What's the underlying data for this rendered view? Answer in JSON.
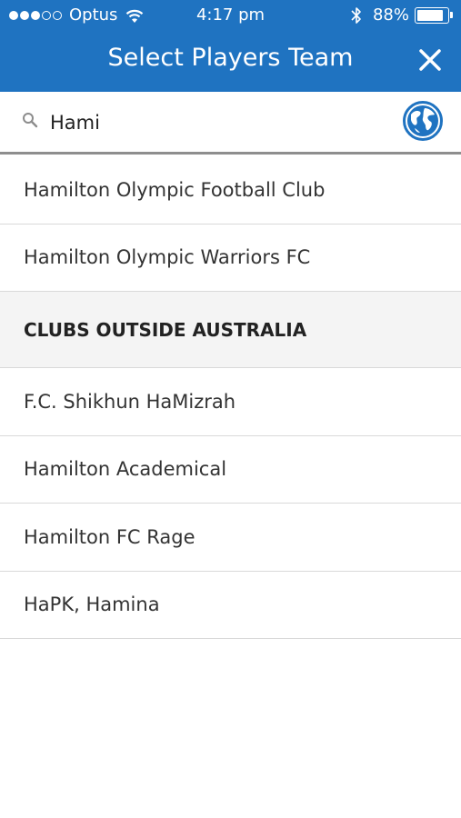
{
  "status_bar": {
    "carrier": "Optus",
    "time": "4:17 pm",
    "battery": "88%",
    "battery_level": 0.88
  },
  "header": {
    "title": "Select Players Team",
    "close_icon": "close-icon"
  },
  "search": {
    "value": "Hami",
    "icon": "search-icon",
    "globe_icon": "globe-icon"
  },
  "results": [
    {
      "label": "Hamilton Olympic Football Club"
    },
    {
      "label": "Hamilton Olympic Warriors FC"
    }
  ],
  "section": {
    "title": "CLUBS OUTSIDE AUSTRALIA"
  },
  "outside_results": [
    {
      "label": "F.C. Shikhun HaMizrah"
    },
    {
      "label": "Hamilton Academical"
    },
    {
      "label": "Hamilton FC Rage"
    },
    {
      "label": "HaPK, Hamina"
    }
  ],
  "colors": {
    "header_blue": "#1f73c1",
    "section_bg": "#f4f4f4"
  }
}
